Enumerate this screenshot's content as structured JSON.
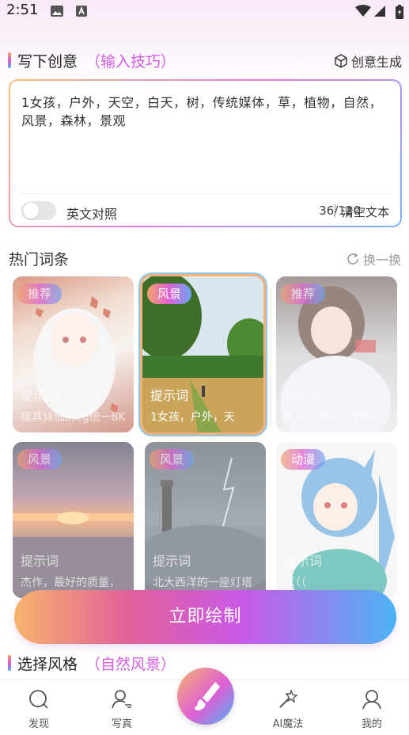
{
  "status_bar": {
    "time": "2:51"
  },
  "creative": {
    "title": "写下创意",
    "tips_link": "（输入技巧）",
    "generate_label": "创意生成",
    "prompt_text": "1女孩，户外，天空，白天，树，传统媒体，草，植物，自然，风景，森林，景观",
    "english_toggle_label": "英文对照",
    "english_toggle_on": false,
    "char_count": "36/120",
    "clear_label": "清空文本"
  },
  "hot": {
    "title": "热门词条",
    "refresh_label": "换一换",
    "cards": [
      {
        "badge": "推荐",
        "title": "提示词",
        "desc": "极其详细的cg统一8K",
        "selected": false
      },
      {
        "badge": "风景",
        "title": "提示词",
        "desc": "1女孩，户外，天",
        "selected": true
      },
      {
        "badge": "推荐",
        "title": "提示词",
        "desc": "女孩，宇宙，宇宙",
        "selected": false
      },
      {
        "badge": "风景",
        "title": "提示词",
        "desc": "杰作，最好的质量，",
        "selected": false
      },
      {
        "badge": "风景",
        "title": "提示词",
        "desc": "北大西洋的一座灯塔",
        "selected": false
      },
      {
        "badge": "动漫",
        "title": "提示词",
        "desc": "（（（",
        "selected": false
      }
    ]
  },
  "draw_button_label": "立即绘制",
  "style_section": {
    "title": "选择风格",
    "current": "（自然风景）"
  },
  "bottom_nav": {
    "items": [
      {
        "label": "发现",
        "icon": "discover-icon"
      },
      {
        "label": "写真",
        "icon": "portrait-icon"
      },
      {
        "label": "",
        "icon": "brush-icon"
      },
      {
        "label": "AI魔法",
        "icon": "magic-wand-icon"
      },
      {
        "label": "我的",
        "icon": "profile-icon"
      }
    ]
  },
  "colors": {
    "accent_pink": "#d35ee3",
    "accent_blue": "#4db4f6",
    "accent_orange": "#f6b46c"
  }
}
